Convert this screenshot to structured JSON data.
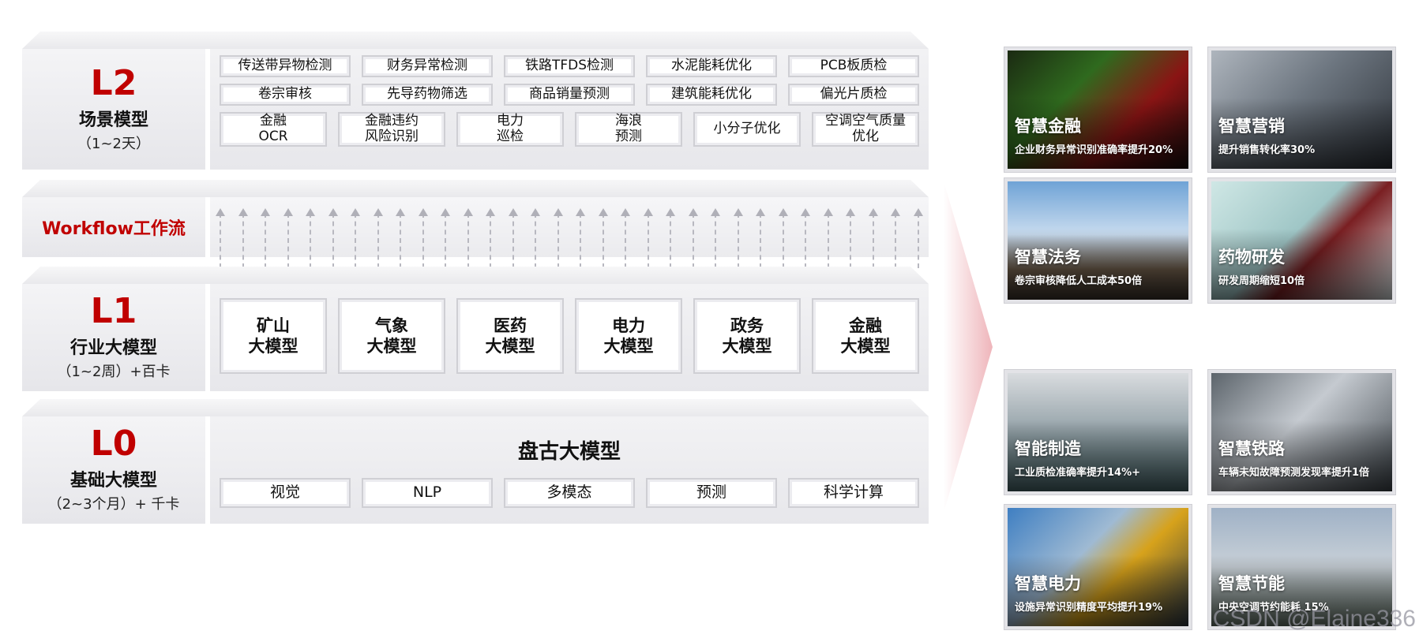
{
  "layers": {
    "l2": {
      "level": "L2",
      "name": "场景模型",
      "duration": "（1~2天）",
      "scenarios": [
        [
          "传送带异物检测",
          "财务异常检测",
          "铁路TFDS检测",
          "水泥能耗优化",
          "PCB板质检"
        ],
        [
          "卷宗审核",
          "先导药物筛选",
          "商品销量预测",
          "建筑能耗优化",
          "偏光片质检"
        ],
        [
          "金融\nOCR",
          "金融违约\n风险识别",
          "电力\n巡检",
          "海浪\n预测",
          "小分子优化",
          "空调空气质量\n优化"
        ]
      ]
    },
    "workflow": {
      "title": "Workflow工作流"
    },
    "l1": {
      "level": "L1",
      "name": "行业大模型",
      "duration": "（1~2周）+百卡",
      "industries": [
        "矿山\n大模型",
        "气象\n大模型",
        "医药\n大模型",
        "电力\n大模型",
        "政务\n大模型",
        "金融\n大模型"
      ]
    },
    "l0": {
      "level": "L0",
      "name": "基础大模型",
      "duration": "（2~3个月）+ 千卡",
      "title": "盘古大模型",
      "modules": [
        "视觉",
        "NLP",
        "多模态",
        "预测",
        "科学计算"
      ]
    }
  },
  "cards": [
    {
      "title": "智慧金融",
      "desc": "企业财务异常识别准确率提升20%"
    },
    {
      "title": "智慧营销",
      "desc": "提升销售转化率30%"
    },
    {
      "title": "智慧法务",
      "desc": "卷宗审核降低人工成本50倍"
    },
    {
      "title": "药物研发",
      "desc": "研发周期缩短10倍"
    },
    {
      "title": "智能制造",
      "desc": "工业质检准确率提升14%+"
    },
    {
      "title": "智慧铁路",
      "desc": "车辆未知故障预测发现率提升1倍"
    },
    {
      "title": "智慧电力",
      "desc": "设施异常识别精度平均提升19%"
    },
    {
      "title": "智慧节能",
      "desc": "中央空调节约能耗 15%"
    }
  ],
  "watermark": "CSDN @Elaine336",
  "colors": {
    "accent_red": "#c00000",
    "slab_gray": "#ececf0"
  }
}
